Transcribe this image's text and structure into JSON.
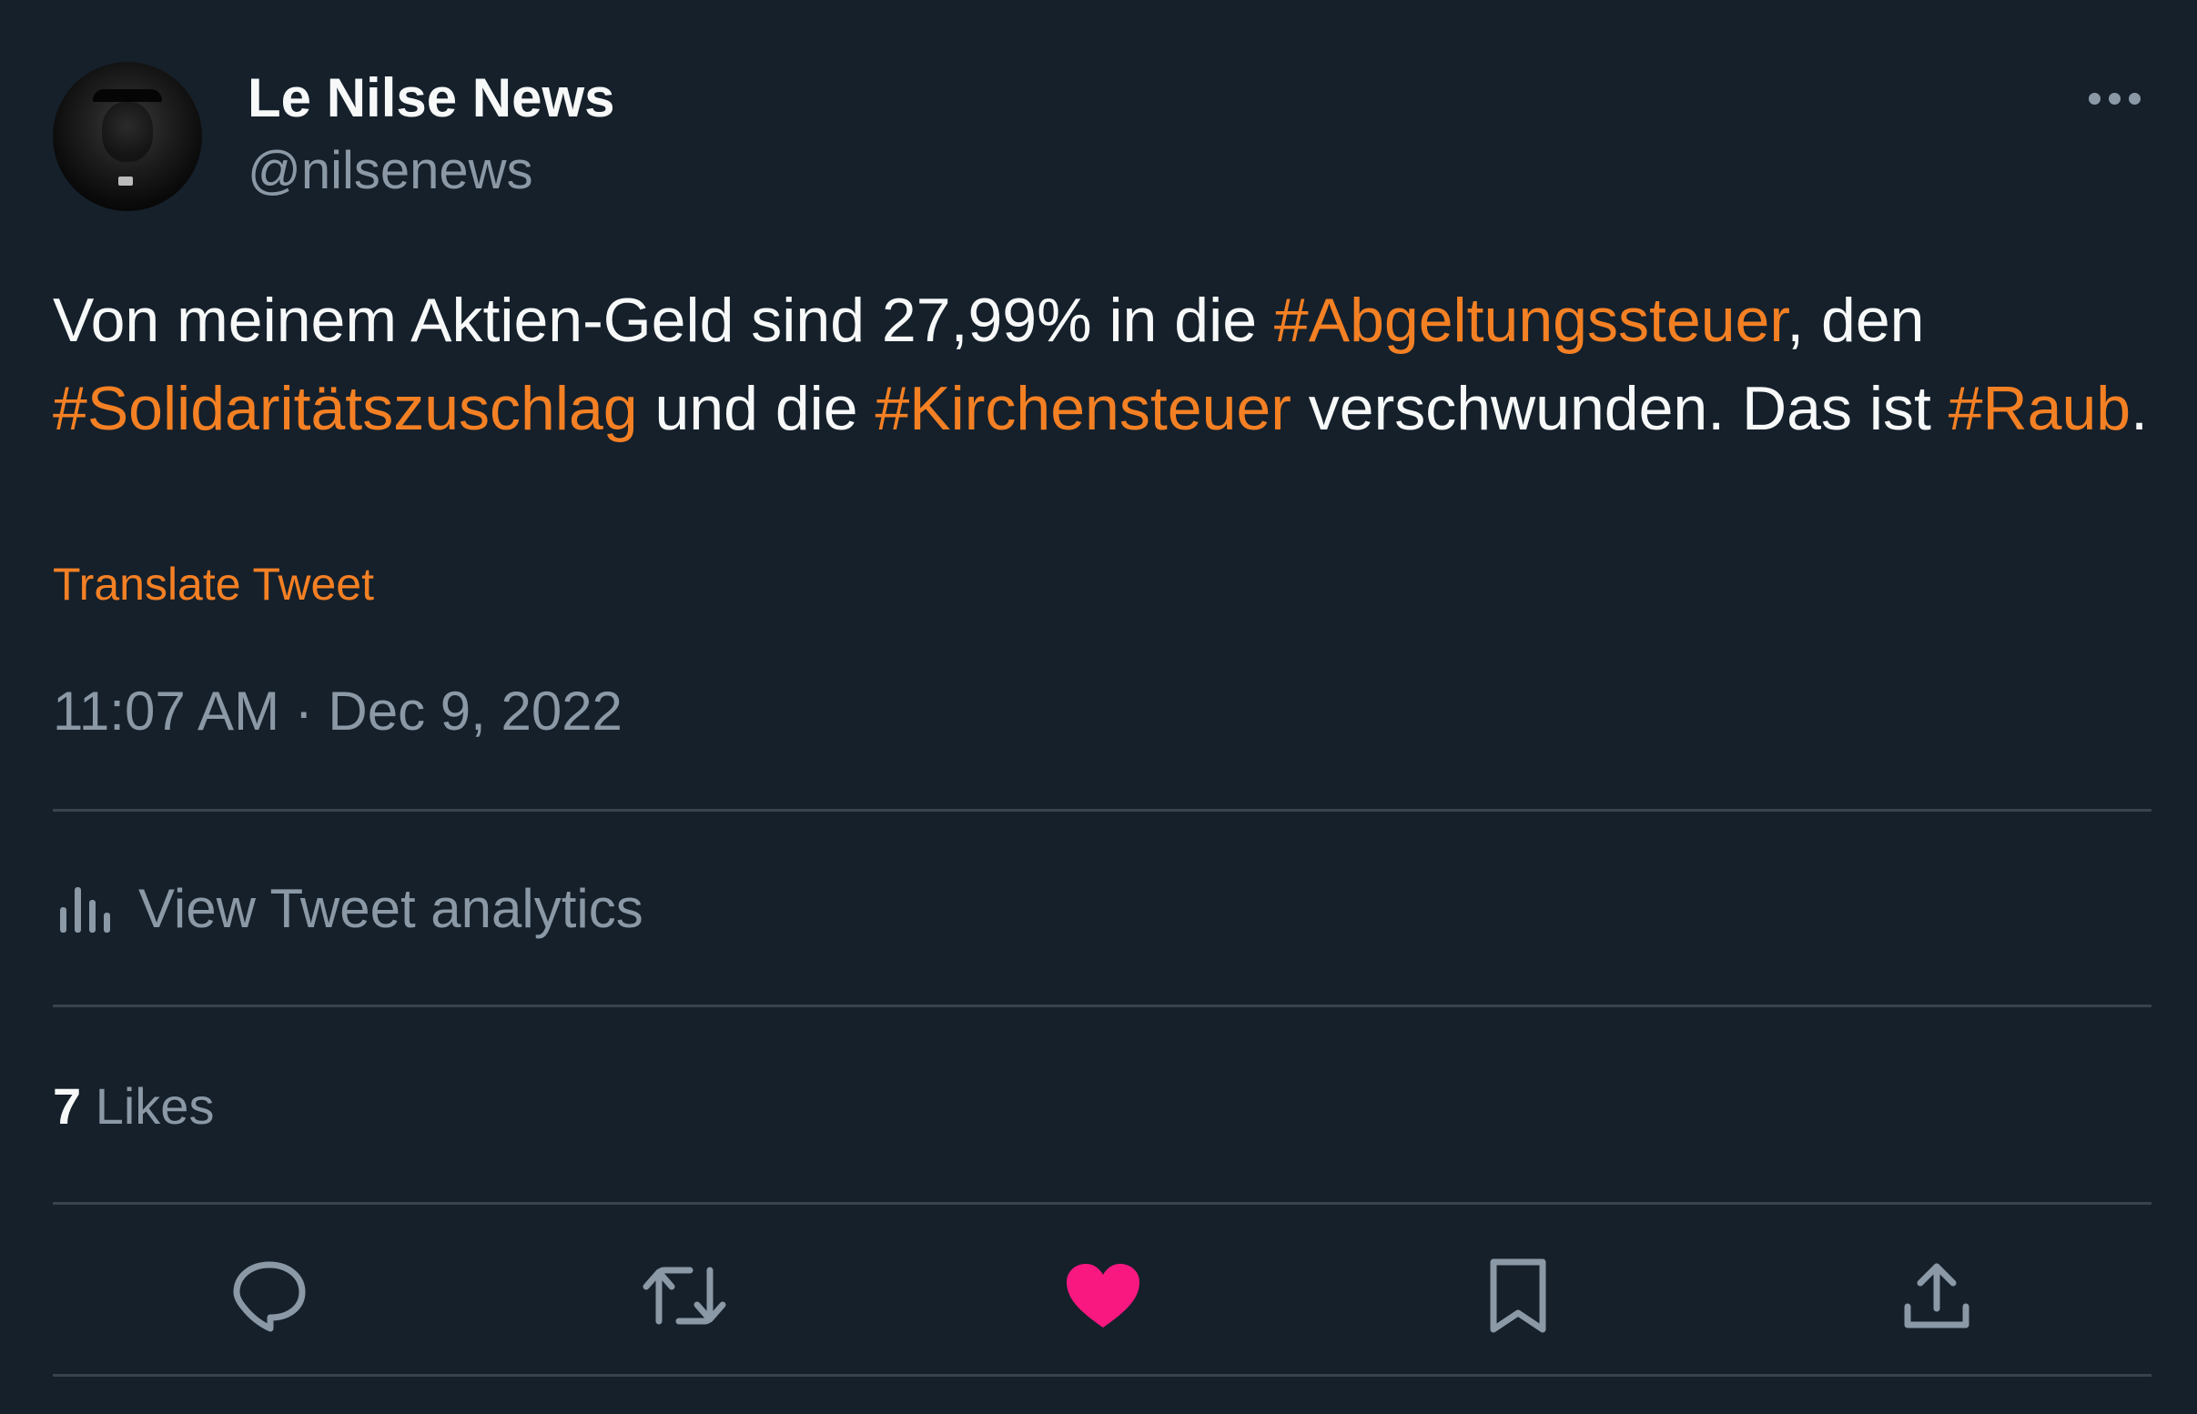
{
  "user": {
    "display_name": "Le Nilse News",
    "handle": "@nilsenews",
    "avatar_icon": "profile-photo"
  },
  "tweet": {
    "segments": [
      {
        "text": "Von meinem Aktien-Geld sind 27,99% in die ",
        "hashtag": false
      },
      {
        "text": "#Abgeltungssteuer",
        "hashtag": true
      },
      {
        "text": ", den ",
        "hashtag": false
      },
      {
        "text": "#Solidaritätszuschlag",
        "hashtag": true
      },
      {
        "text": " und die ",
        "hashtag": false
      },
      {
        "text": "#Kirchensteuer",
        "hashtag": true
      },
      {
        "text": " verschwunden. Das ist ",
        "hashtag": false
      },
      {
        "text": "#Raub",
        "hashtag": true
      },
      {
        "text": ".",
        "hashtag": false
      }
    ],
    "translate_label": "Translate Tweet",
    "timestamp": "11:07 AM · Dec 9, 2022"
  },
  "analytics": {
    "label": "View Tweet analytics",
    "icon": "bar-chart-icon"
  },
  "stats": {
    "likes_count": "7",
    "likes_label": "Likes"
  },
  "actions": [
    {
      "name": "reply",
      "icon": "speech-bubble-icon"
    },
    {
      "name": "retweet",
      "icon": "retweet-arrows-icon"
    },
    {
      "name": "like",
      "icon": "heart-icon",
      "active": true
    },
    {
      "name": "bookmark",
      "icon": "bookmark-icon"
    },
    {
      "name": "share",
      "icon": "share-upload-icon"
    }
  ],
  "colors": {
    "background": "#15202b",
    "text_primary": "#f7f9f9",
    "text_secondary": "#8b98a5",
    "accent": "#f48024",
    "like_active": "#f91880",
    "divider": "#38444d"
  }
}
